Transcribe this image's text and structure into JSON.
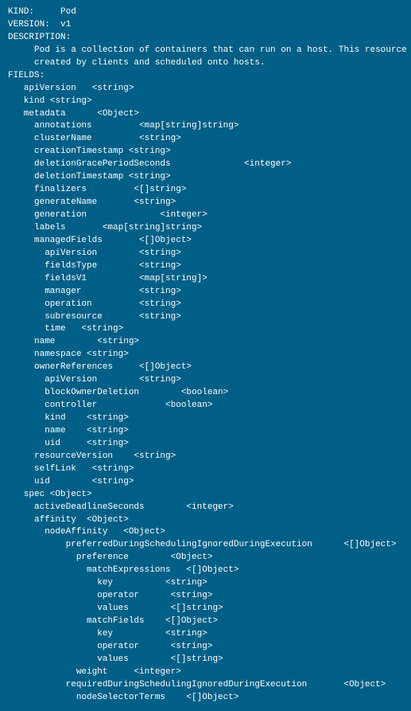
{
  "lines": [
    {
      "text": "KIND:     Pod",
      "indent": 0
    },
    {
      "text": "VERSION:  v1",
      "indent": 0
    },
    {
      "text": "",
      "indent": 0
    },
    {
      "text": "DESCRIPTION:",
      "indent": 0
    },
    {
      "text": "     Pod is a collection of containers that can run on a host. This resource is",
      "indent": 0
    },
    {
      "text": "     created by clients and scheduled onto hosts.",
      "indent": 0
    },
    {
      "text": "",
      "indent": 0
    },
    {
      "text": "FIELDS:",
      "indent": 0
    },
    {
      "text": "   apiVersion   <string>",
      "indent": 0
    },
    {
      "text": "   kind <string>",
      "indent": 0
    },
    {
      "text": "   metadata      <Object>",
      "indent": 0
    },
    {
      "text": "     annotations         <map[string]string>",
      "indent": 0
    },
    {
      "text": "     clusterName         <string>",
      "indent": 0
    },
    {
      "text": "     creationTimestamp <string>",
      "indent": 0
    },
    {
      "text": "     deletionGracePeriodSeconds              <integer>",
      "indent": 0
    },
    {
      "text": "     deletionTimestamp <string>",
      "indent": 0
    },
    {
      "text": "     finalizers         <[]string>",
      "indent": 0
    },
    {
      "text": "     generateName       <string>",
      "indent": 0
    },
    {
      "text": "     generation              <integer>",
      "indent": 0
    },
    {
      "text": "     labels       <map[string]string>",
      "indent": 0
    },
    {
      "text": "     managedFields       <[]Object>",
      "indent": 0
    },
    {
      "text": "       apiVersion        <string>",
      "indent": 0
    },
    {
      "text": "       fieldsType        <string>",
      "indent": 0
    },
    {
      "text": "       fieldsV1          <map[string]>",
      "indent": 0
    },
    {
      "text": "       manager           <string>",
      "indent": 0
    },
    {
      "text": "       operation         <string>",
      "indent": 0
    },
    {
      "text": "       subresource       <string>",
      "indent": 0
    },
    {
      "text": "       time   <string>",
      "indent": 0
    },
    {
      "text": "     name        <string>",
      "indent": 0
    },
    {
      "text": "     namespace <string>",
      "indent": 0
    },
    {
      "text": "     ownerReferences     <[]Object>",
      "indent": 0
    },
    {
      "text": "       apiVersion        <string>",
      "indent": 0
    },
    {
      "text": "       blockOwnerDeletion        <boolean>",
      "indent": 0
    },
    {
      "text": "       controller             <boolean>",
      "indent": 0
    },
    {
      "text": "       kind    <string>",
      "indent": 0
    },
    {
      "text": "       name    <string>",
      "indent": 0
    },
    {
      "text": "       uid     <string>",
      "indent": 0
    },
    {
      "text": "     resourceVersion    <string>",
      "indent": 0
    },
    {
      "text": "     selfLink   <string>",
      "indent": 0
    },
    {
      "text": "     uid        <string>",
      "indent": 0
    },
    {
      "text": "   spec <Object>",
      "indent": 0
    },
    {
      "text": "     activeDeadlineSeconds        <integer>",
      "indent": 0
    },
    {
      "text": "     affinity  <Object>",
      "indent": 0
    },
    {
      "text": "       nodeAffinity   <Object>",
      "indent": 0
    },
    {
      "text": "           preferredDuringSchedulingIgnoredDuringExecution      <[]Object>",
      "indent": 0
    },
    {
      "text": "             preference        <Object>",
      "indent": 0
    },
    {
      "text": "               matchExpressions   <[]Object>",
      "indent": 0
    },
    {
      "text": "                 key          <string>",
      "indent": 0
    },
    {
      "text": "                 operator      <string>",
      "indent": 0
    },
    {
      "text": "                 values        <[]string>",
      "indent": 0
    },
    {
      "text": "               matchFields    <[]Object>",
      "indent": 0
    },
    {
      "text": "                 key          <string>",
      "indent": 0
    },
    {
      "text": "                 operator      <string>",
      "indent": 0
    },
    {
      "text": "                 values        <[]string>",
      "indent": 0
    },
    {
      "text": "             weight     <integer>",
      "indent": 0
    },
    {
      "text": "           requiredDuringSchedulingIgnoredDuringExecution       <Object>",
      "indent": 0
    },
    {
      "text": "             nodeSelectorTerms    <[]Object>",
      "indent": 0
    }
  ]
}
